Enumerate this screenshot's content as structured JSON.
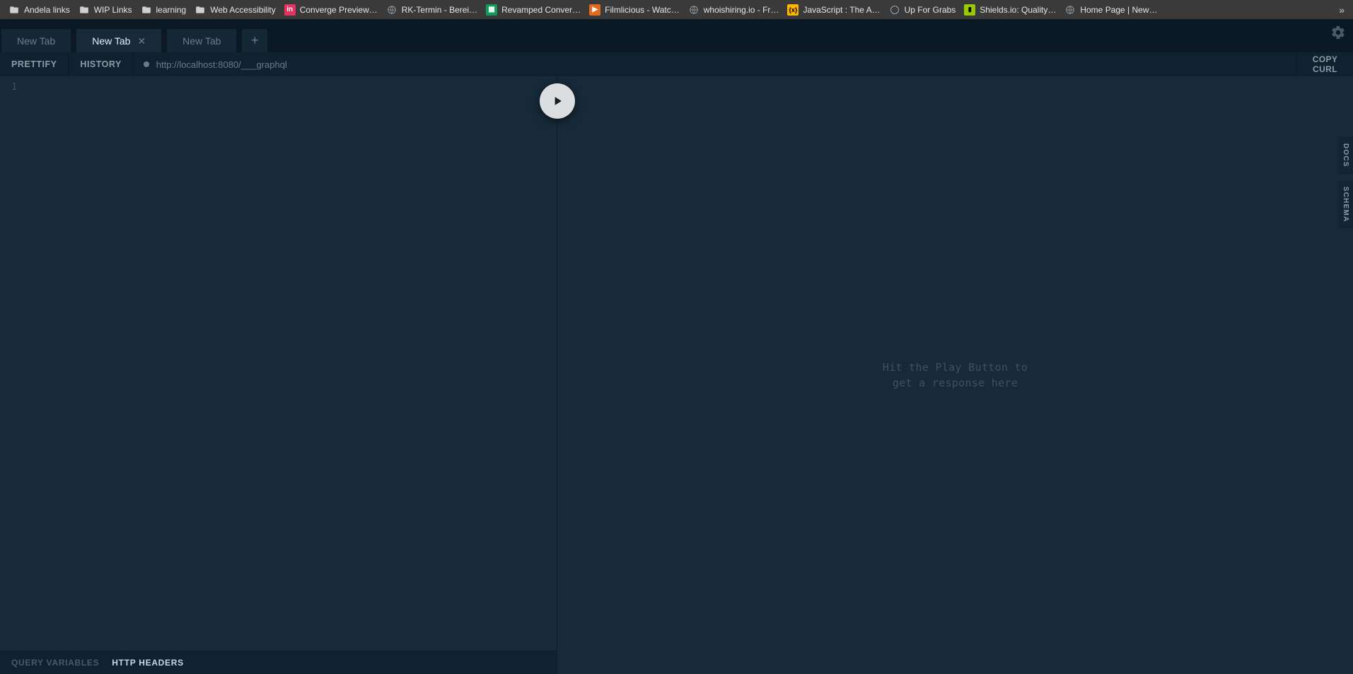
{
  "bookmarks": [
    {
      "label": "Andela links",
      "icon": "folder"
    },
    {
      "label": "WIP Links",
      "icon": "folder"
    },
    {
      "label": "learning",
      "icon": "folder"
    },
    {
      "label": "Web Accessibility",
      "icon": "folder"
    },
    {
      "label": "Converge Preview…",
      "icon": "invision"
    },
    {
      "label": "RK-Termin - Berei…",
      "icon": "globe"
    },
    {
      "label": "Revamped Conver…",
      "icon": "sheets"
    },
    {
      "label": "Filmlicious - Watc…",
      "icon": "film"
    },
    {
      "label": "whoishiring.io - Fr…",
      "icon": "globe"
    },
    {
      "label": "JavaScript : The A…",
      "icon": "js"
    },
    {
      "label": "Up For Grabs",
      "icon": "circle"
    },
    {
      "label": "Shields.io: Quality…",
      "icon": "shields"
    },
    {
      "label": "Home Page | New…",
      "icon": "globe"
    }
  ],
  "overflow_glyph": "»",
  "tabs": [
    {
      "label": "New Tab",
      "active": false
    },
    {
      "label": "New Tab",
      "active": true
    },
    {
      "label": "New Tab",
      "active": false
    }
  ],
  "new_tab_glyph": "+",
  "toolbar": {
    "prettify": "PRETTIFY",
    "history": "HISTORY",
    "url": "http://localhost:8080/___graphql",
    "copy_curl": "COPY CURL"
  },
  "editor": {
    "first_line_no": "1"
  },
  "bottom_tabs": {
    "variables": "QUERY VARIABLES",
    "headers": "HTTP HEADERS"
  },
  "right_placeholder_l1": "Hit the Play Button to",
  "right_placeholder_l2": "get a response here",
  "side": {
    "docs": "DOCS",
    "schema": "SCHEMA"
  }
}
